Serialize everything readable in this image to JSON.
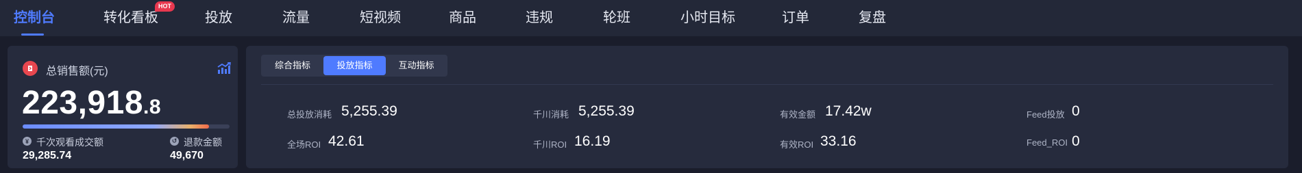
{
  "nav": {
    "items": [
      {
        "label": "控制台",
        "active": true
      },
      {
        "label": "转化看板",
        "badge": "HOT"
      },
      {
        "label": "投放"
      },
      {
        "label": "流量"
      },
      {
        "label": "短视频"
      },
      {
        "label": "商品"
      },
      {
        "label": "违规"
      },
      {
        "label": "轮班"
      },
      {
        "label": "小时目标"
      },
      {
        "label": "订单"
      },
      {
        "label": "复盘"
      }
    ]
  },
  "sales": {
    "title": "总销售额(元)",
    "value_int": "223,918",
    "value_dec": ".8",
    "progress": 0.9,
    "left_label": "千次观看成交额",
    "left_value": "29,285.74",
    "right_label": "退款金额",
    "right_value": "49,670",
    "icon": "sales-icon",
    "accent": "#4f7bff"
  },
  "tabs": [
    "综合指标",
    "投放指标",
    "互动指标"
  ],
  "metrics": [
    {
      "label": "总投放消耗",
      "value": "5,255.39"
    },
    {
      "label": "千川消耗",
      "value": "5,255.39"
    },
    {
      "label": "有效金额",
      "value": "17.42w"
    },
    {
      "label": "Feed投放",
      "value": "0"
    },
    {
      "label": "全场ROI",
      "value": "42.61"
    },
    {
      "label": "千川ROI",
      "value": "16.19"
    },
    {
      "label": "有效ROI",
      "value": "33.16"
    },
    {
      "label": "Feed_ROI",
      "value": "0"
    }
  ]
}
